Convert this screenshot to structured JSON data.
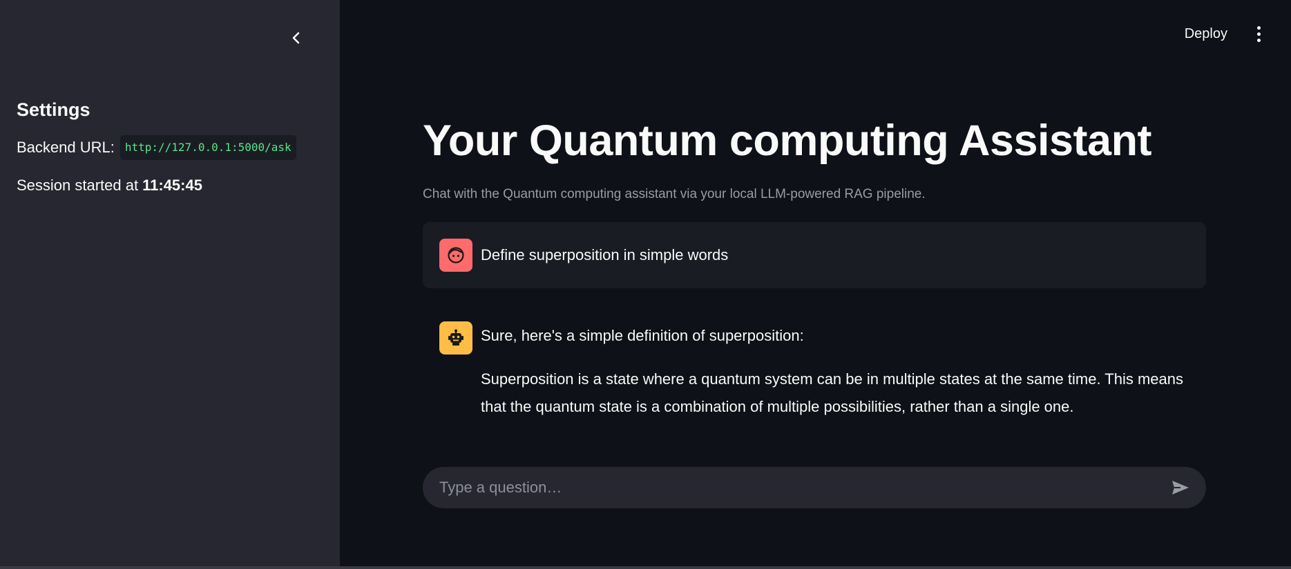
{
  "sidebar": {
    "collapse_icon": "chevron-left-icon",
    "heading": "Settings",
    "backend_label": "Backend URL:",
    "backend_url": "http://127.0.0.1:5000/ask",
    "session_label": "Session started at",
    "session_time": "11:45:45"
  },
  "header": {
    "deploy_label": "Deploy",
    "menu_icon": "more-vertical-icon"
  },
  "main": {
    "title": "Your Quantum computing Assistant",
    "caption": "Chat with the Quantum computing assistant via your local LLM-powered RAG pipeline.",
    "messages": [
      {
        "role": "user",
        "avatar_icon": "user-face-icon",
        "text": "Define superposition in simple words"
      },
      {
        "role": "assistant",
        "avatar_icon": "robot-icon",
        "intro": "Sure, here's a simple definition of superposition:",
        "paragraph": "Superposition is a state where a quantum system can be in multiple states at the same time. This means that the quantum state is a combination of multiple possibilities, rather than a single one."
      }
    ]
  },
  "chat_input": {
    "placeholder": "Type a question…",
    "value": "",
    "send_icon": "send-icon"
  },
  "colors": {
    "sidebar_bg": "#262730",
    "main_bg": "#0e1117",
    "user_avatar": "#ff6b6b",
    "assistant_avatar": "#ffbd45",
    "code_text": "#5ce488"
  }
}
